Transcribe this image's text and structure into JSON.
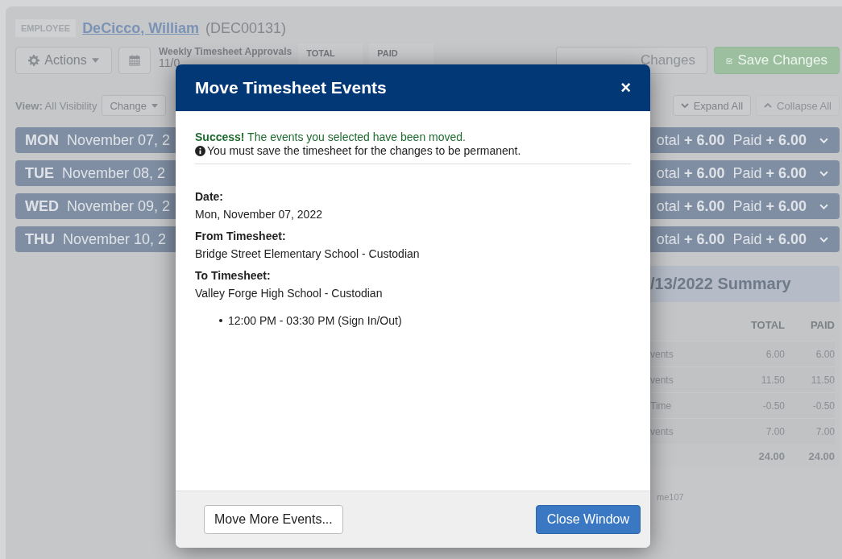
{
  "employee": {
    "badge": "EMPLOYEE",
    "name": "DeCicco, William",
    "id": "(DEC00131)"
  },
  "toolbar": {
    "actions": "Actions",
    "period_title": "Weekly Timesheet Approvals",
    "period_range": "11/0",
    "total_label": "TOTAL",
    "paid_label": "PAID",
    "cancel": "Changes",
    "save": "Save Changes"
  },
  "view": {
    "label": "View:",
    "value": "All Visibility",
    "change": "Change",
    "expand": {
      "label": "Expand All",
      "disabled": false
    },
    "collapse": {
      "label": "Collapse All",
      "disabled": true
    }
  },
  "days": [
    {
      "day": "MON",
      "date": "November 07, 2",
      "total_label": "otal",
      "total": "+ 6.00",
      "paid_label": "Paid",
      "paid": "+ 6.00"
    },
    {
      "day": "TUE",
      "date": "November 08, 2",
      "total_label": "otal",
      "total": "+ 6.00",
      "paid_label": "Paid",
      "paid": "+ 6.00"
    },
    {
      "day": "WED",
      "date": "November 09, 2",
      "total_label": "otal",
      "total": "+ 6.00",
      "paid_label": "Paid",
      "paid": "+ 6.00"
    },
    {
      "day": "THU",
      "date": "November 10, 2",
      "total_label": "otal",
      "total": "+ 6.00",
      "paid_label": "Paid",
      "paid": "+ 6.00"
    }
  ],
  "summary": {
    "title": "/13/2022 Summary",
    "columns": [
      "TOTAL",
      "PAID"
    ],
    "rows": [
      {
        "label": "vents",
        "total": "6.00",
        "paid": "6.00"
      },
      {
        "label": "vents",
        "total": "11.50",
        "paid": "11.50"
      },
      {
        "label": "Time",
        "total": "-0.50",
        "paid": "-0.50"
      },
      {
        "label": "vents",
        "total": "7.00",
        "paid": "7.00"
      }
    ],
    "totals": {
      "total": "24.00",
      "paid": "24.00"
    }
  },
  "footer_note": "me107",
  "modal": {
    "title": "Move Timesheet Events",
    "close": "×",
    "success": "**Success!** The events you selected have been moved.",
    "notice": "You must save the timesheet for the changes to be permanent.",
    "fields": [
      {
        "label": "Date:",
        "value": "Mon, November 07, 2022"
      },
      {
        "label": "From Timesheet:",
        "value": "Bridge Street Elementary School - Custodian"
      },
      {
        "label": "To Timesheet:",
        "value": "Valley Forge High School - Custodian"
      }
    ],
    "events": [
      "12:00 PM - 03:30 PM (Sign In/Out)"
    ],
    "buttons": [
      {
        "label": "Move More Events...",
        "kind": "default"
      },
      {
        "label": "Close Window",
        "kind": "primary"
      }
    ]
  }
}
